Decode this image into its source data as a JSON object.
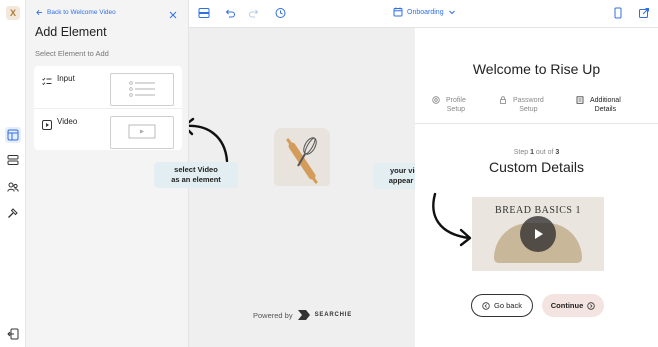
{
  "colors": {
    "accent": "#2f6fe0",
    "callout_bg": "#e2eef1",
    "continue_bg": "#f3e4e1"
  },
  "rail": {
    "logo_text": "X",
    "icons": [
      "layout-icon",
      "layers-icon",
      "users-icon",
      "hammer-icon",
      "exit-icon"
    ]
  },
  "panel": {
    "back_label": "Back to Welcome Video",
    "title": "Add Element",
    "subtitle": "Select Element to Add",
    "elements": [
      {
        "label": "Input",
        "icon": "list-check-icon"
      },
      {
        "label": "Video",
        "icon": "play-square-icon"
      }
    ]
  },
  "toolbar": {
    "flow_name": "Onboarding",
    "icons": [
      "sidebar-icon",
      "undo-icon",
      "redo-icon",
      "history-icon",
      "mobile-preview-icon",
      "open-external-icon"
    ]
  },
  "canvas": {
    "callout_left": {
      "line1": "select Video",
      "line2": "as an element"
    },
    "callout_right": {
      "line1": "your video will",
      "line2": "appear like this"
    },
    "powered_by": "Powered by",
    "brand": "SEARCHIE"
  },
  "preview": {
    "title": "Welcome to Rise Up",
    "steps": [
      {
        "line1": "Profile",
        "line2": "Setup",
        "icon": "at-icon"
      },
      {
        "line1": "Password",
        "line2": "Setup",
        "icon": "lock-icon"
      },
      {
        "line1": "Additional",
        "line2": "Details",
        "icon": "document-icon"
      }
    ],
    "step_prefix": "Step",
    "step_current": "1",
    "step_middle": "out of",
    "step_total": "3",
    "section_title": "Custom Details",
    "video_title": "BREAD BASICS 1",
    "back_button": "Go back",
    "continue_button": "Continue"
  }
}
